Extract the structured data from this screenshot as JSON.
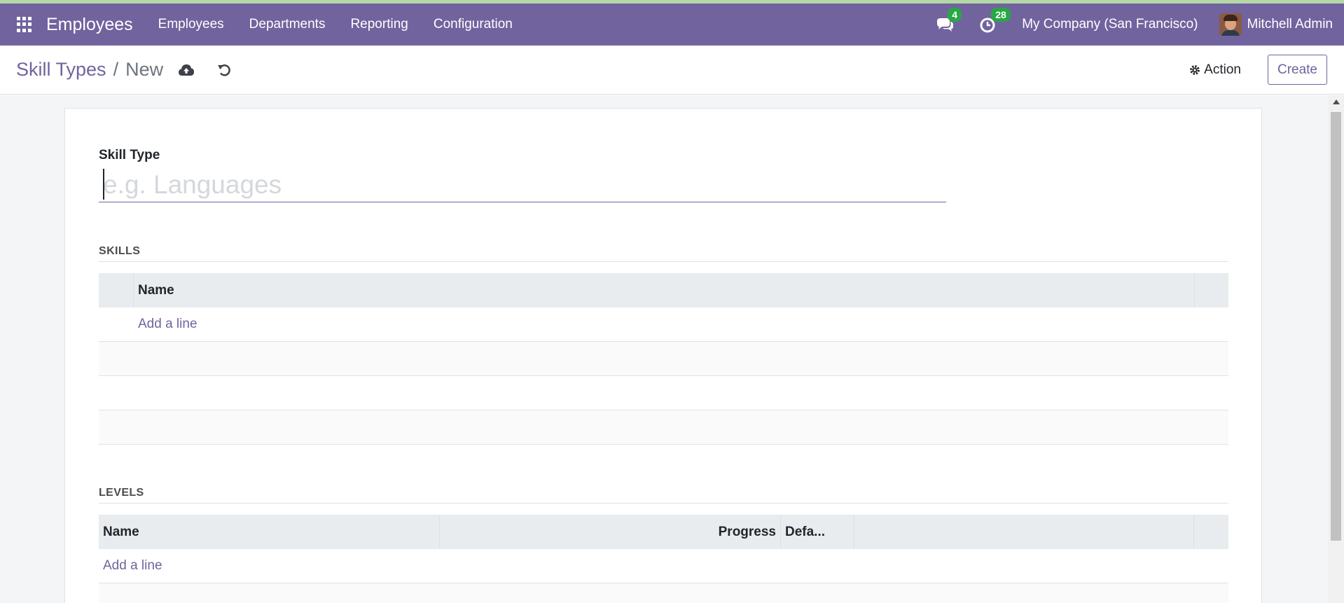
{
  "navbar": {
    "app_name": "Employees",
    "menu": [
      "Employees",
      "Departments",
      "Reporting",
      "Configuration"
    ],
    "messages_count": "4",
    "activities_count": "28",
    "company": "My Company (San Francisco)",
    "user_name": "Mitchell Admin"
  },
  "breadcrumb": {
    "parent": "Skill Types",
    "separator": "/",
    "current": "New"
  },
  "control_panel": {
    "action_label": "Action",
    "create_label": "Create"
  },
  "form": {
    "skill_type_label": "Skill Type",
    "skill_type_value": "",
    "skill_type_placeholder": "e.g. Languages",
    "skills_section": "SKILLS",
    "skills_columns": [
      "Name"
    ],
    "skills_add_line": "Add a line",
    "levels_section": "LEVELS",
    "levels_columns": [
      "Name",
      "Progress",
      "Defa..."
    ],
    "levels_add_line": "Add a line"
  },
  "colors": {
    "brand": "#71639e",
    "badge": "#28a745",
    "header_bg": "#e9ecef"
  }
}
